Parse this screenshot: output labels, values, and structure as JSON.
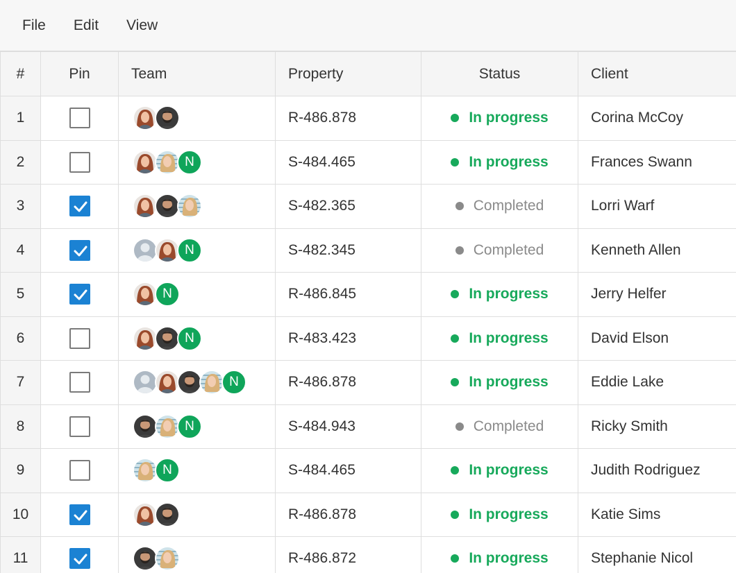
{
  "menu": {
    "file": "File",
    "edit": "Edit",
    "view": "View"
  },
  "columns": {
    "num": "#",
    "pin": "Pin",
    "team": "Team",
    "property": "Property",
    "status": "Status",
    "client": "Client"
  },
  "colors": {
    "accent": "#1b82d3",
    "in_progress": "#17a95b",
    "completed": "#8a8a8a",
    "avatar_initial_bg": "#0fa55a"
  },
  "rows": [
    {
      "num": "1",
      "pinned": false,
      "team": [
        "woman-red",
        "man-beard"
      ],
      "property": "R-486.878",
      "status": "In progress",
      "client": "Corina McCoy"
    },
    {
      "num": "2",
      "pinned": false,
      "team": [
        "woman-red",
        "woman-blonde",
        "N"
      ],
      "property": "S-484.465",
      "status": "In progress",
      "client": "Frances Swann"
    },
    {
      "num": "3",
      "pinned": true,
      "team": [
        "woman-red",
        "man-beard",
        "woman-blonde"
      ],
      "property": "S-482.365",
      "status": "Completed",
      "client": "Lorri Warf"
    },
    {
      "num": "4",
      "pinned": true,
      "team": [
        "placeholder",
        "woman-red",
        "N"
      ],
      "property": "S-482.345",
      "status": "Completed",
      "client": "Kenneth Allen"
    },
    {
      "num": "5",
      "pinned": true,
      "team": [
        "woman-red",
        "N"
      ],
      "property": "R-486.845",
      "status": "In progress",
      "client": "Jerry Helfer"
    },
    {
      "num": "6",
      "pinned": false,
      "team": [
        "woman-red",
        "man-beard",
        "N"
      ],
      "property": "R-483.423",
      "status": "In progress",
      "client": "David Elson"
    },
    {
      "num": "7",
      "pinned": false,
      "team": [
        "placeholder",
        "woman-red",
        "man-beard",
        "woman-blonde",
        "N"
      ],
      "property": "R-486.878",
      "status": "In progress",
      "client": "Eddie Lake"
    },
    {
      "num": "8",
      "pinned": false,
      "team": [
        "man-beard",
        "woman-blonde",
        "N"
      ],
      "property": "S-484.943",
      "status": "Completed",
      "client": "Ricky Smith"
    },
    {
      "num": "9",
      "pinned": false,
      "team": [
        "woman-blonde",
        "N"
      ],
      "property": "S-484.465",
      "status": "In progress",
      "client": "Judith Rodriguez"
    },
    {
      "num": "10",
      "pinned": true,
      "team": [
        "woman-red",
        "man-beard"
      ],
      "property": "R-486.878",
      "status": "In progress",
      "client": "Katie Sims"
    },
    {
      "num": "11",
      "pinned": true,
      "team": [
        "man-beard",
        "woman-blonde"
      ],
      "property": "R-486.872",
      "status": "In progress",
      "client": "Stephanie Nicol"
    }
  ]
}
